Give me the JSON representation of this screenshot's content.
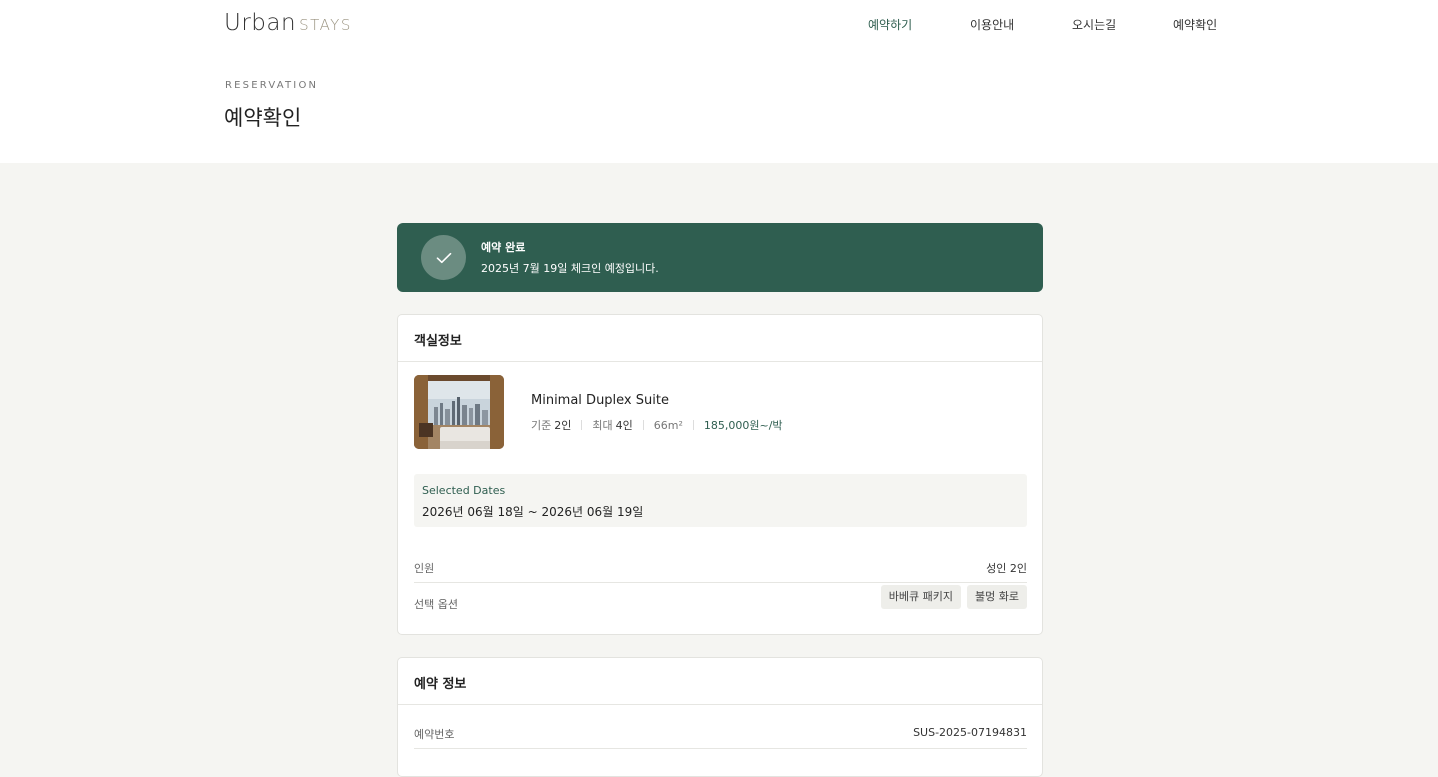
{
  "brand": {
    "word1": "Urban",
    "word2": "STAYS"
  },
  "nav": [
    {
      "label": "예약하기",
      "active": true
    },
    {
      "label": "이용안내",
      "active": false
    },
    {
      "label": "오시는길",
      "active": false
    },
    {
      "label": "예약확인",
      "active": false
    }
  ],
  "header": {
    "eyebrow": "RESERVATION",
    "title": "예약확인"
  },
  "banner": {
    "title": "예약 완료",
    "subtitle": "2025년 7월 19일 체크인 예정입니다.",
    "color": "#2f5e50"
  },
  "room_card": {
    "heading": "객실정보",
    "room_name": "Minimal Duplex Suite",
    "base_label": "기준",
    "base_value": "2인",
    "max_label": "최대",
    "max_value": "4인",
    "area": "66m²",
    "price": "185,000원~/박",
    "dates_label": "Selected Dates",
    "dates_value": "2026년 06월 18일 ~ 2026년 06월 19일",
    "guests_label": "인원",
    "guests_value": "성인 2인",
    "options_label": "선택 옵션",
    "options": [
      "바베큐 패키지",
      "불멍 화로"
    ]
  },
  "reservation_card": {
    "heading": "예약 정보",
    "number_label": "예약번호",
    "number_value": "SUS-2025-07194831"
  }
}
